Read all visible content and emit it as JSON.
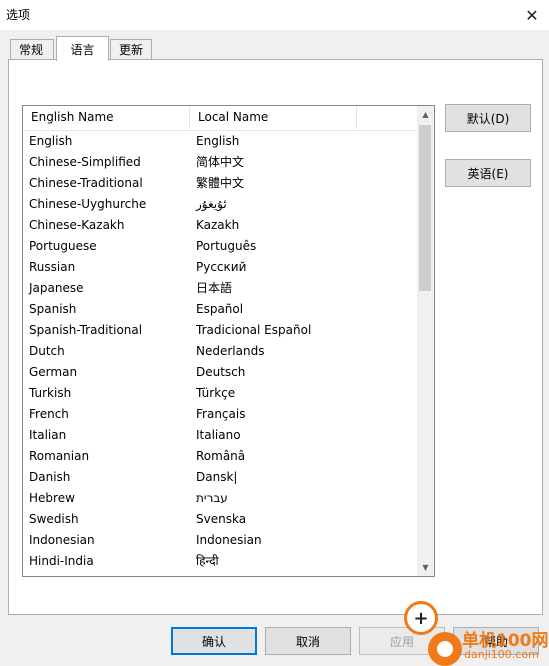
{
  "window": {
    "title": "选项",
    "close_glyph": "✕"
  },
  "tabs": [
    {
      "label": "常规"
    },
    {
      "label": "语言"
    },
    {
      "label": "更新"
    }
  ],
  "list": {
    "columns": [
      "English Name",
      "Local Name"
    ],
    "rows": [
      [
        "English",
        "English"
      ],
      [
        "Chinese-Simplified",
        "简体中文"
      ],
      [
        "Chinese-Traditional",
        "繁體中文"
      ],
      [
        "Chinese-Uyghurche",
        "ئۇيغۇر"
      ],
      [
        "Chinese-Kazakh",
        "Kazakh"
      ],
      [
        "Portuguese",
        "Português"
      ],
      [
        "Russian",
        "Русский"
      ],
      [
        "Japanese",
        "日本語"
      ],
      [
        "Spanish",
        "Español"
      ],
      [
        "Spanish-Traditional",
        "Tradicional Español"
      ],
      [
        "Dutch",
        "Nederlands"
      ],
      [
        "German",
        "Deutsch"
      ],
      [
        "Turkish",
        "Türkçe"
      ],
      [
        "French",
        "Français"
      ],
      [
        "Italian",
        "Italiano"
      ],
      [
        "Romanian",
        "Românâ"
      ],
      [
        "Danish",
        "Dansk|"
      ],
      [
        "Hebrew",
        "עברית"
      ],
      [
        "Swedish",
        "Svenska"
      ],
      [
        "Indonesian",
        "Indonesian"
      ],
      [
        "Hindi-India",
        "हिन्दी"
      ]
    ]
  },
  "side_buttons": {
    "default": "默认(D)",
    "english": "英语(E)"
  },
  "bottom_buttons": {
    "ok": "确认",
    "cancel": "取消",
    "apply": "应用",
    "help": "帮助"
  },
  "watermark": {
    "text1": "单机100网",
    "text2": "danji100.com",
    "accent": "#f07a1a"
  }
}
